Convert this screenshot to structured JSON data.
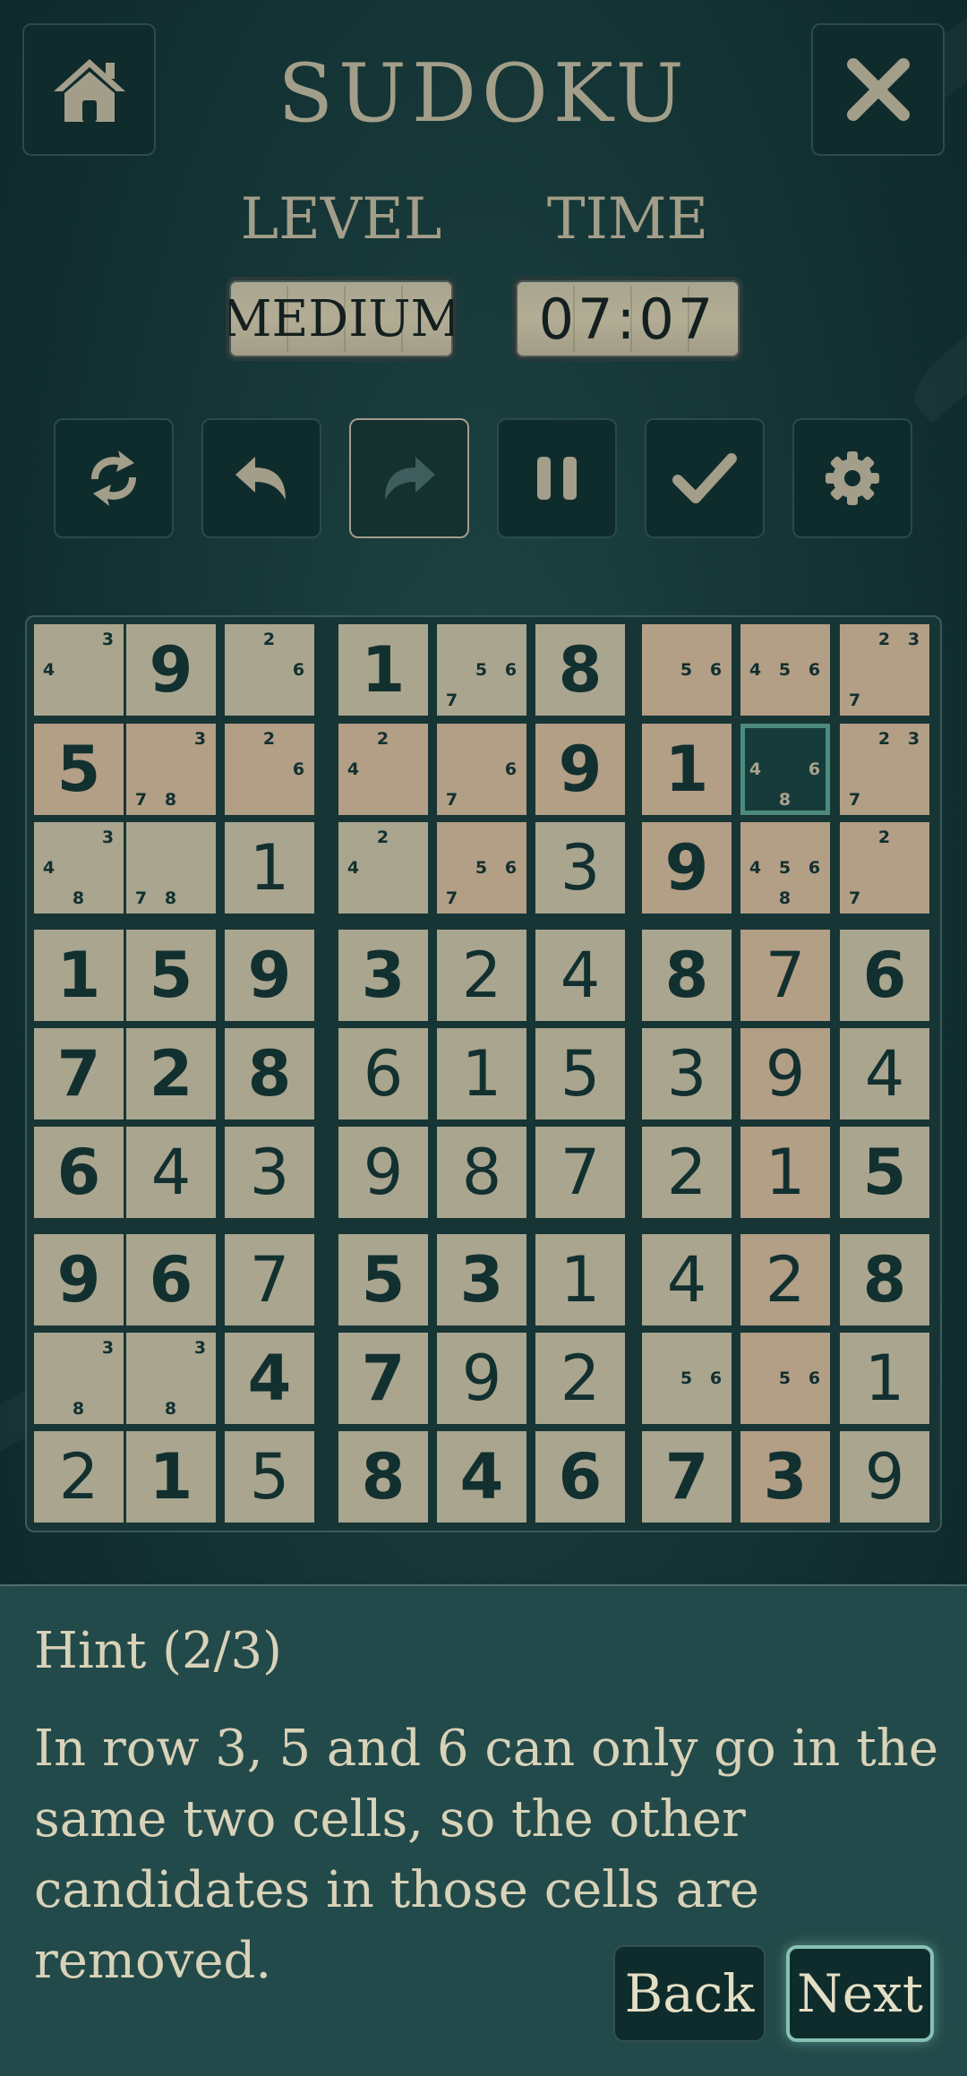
{
  "header": {
    "title": "SUDOKU",
    "level_label": "LEVEL",
    "level_value": "MEDIUM",
    "time_label": "TIME",
    "time_value": "07:07"
  },
  "icons": {
    "home": "home-icon",
    "close": "close-icon",
    "toolbar": [
      "shuffle-icon",
      "undo-icon",
      "redo-icon",
      "pause-icon",
      "check-icon",
      "gear-icon"
    ]
  },
  "colors": {
    "cell": "#aaa58f",
    "cell_highlight": "#b39e86",
    "cell_selected": "#173a3a",
    "selected_border": "#4b8b7e",
    "digit": "#12302f",
    "accent": "#a39e89"
  },
  "board": {
    "rows": [
      [
        {
          "n": [
            3,
            4
          ]
        },
        {
          "v": 9,
          "g": true
        },
        {
          "n": [
            2,
            6
          ]
        },
        {
          "v": 1,
          "g": true
        },
        {
          "n": [
            5,
            6,
            7
          ]
        },
        {
          "v": 8,
          "g": true
        },
        {
          "n": [
            5,
            6
          ],
          "h": true
        },
        {
          "n": [
            4,
            5,
            6
          ],
          "h": true
        },
        {
          "n": [
            2,
            3,
            7
          ],
          "h": true
        }
      ],
      [
        {
          "v": 5,
          "g": true,
          "h": true
        },
        {
          "n": [
            3,
            7,
            8
          ],
          "h": true
        },
        {
          "n": [
            2,
            6
          ],
          "h": true
        },
        {
          "n": [
            2,
            4
          ],
          "h": true
        },
        {
          "n": [
            6,
            7
          ],
          "h": true
        },
        {
          "v": 9,
          "g": true,
          "h": true
        },
        {
          "v": 1,
          "g": true,
          "h": true
        },
        {
          "n": [
            4,
            6,
            8
          ],
          "sel": true
        },
        {
          "n": [
            2,
            3,
            7
          ],
          "h": true
        }
      ],
      [
        {
          "n": [
            3,
            4,
            8
          ]
        },
        {
          "n": [
            7,
            8
          ]
        },
        {
          "v": 1,
          "g": false
        },
        {
          "n": [
            2,
            4
          ]
        },
        {
          "n": [
            5,
            6,
            7
          ],
          "h": true
        },
        {
          "v": 3,
          "g": false
        },
        {
          "v": 9,
          "g": true,
          "h": true
        },
        {
          "n": [
            4,
            5,
            6,
            8
          ],
          "h": true
        },
        {
          "n": [
            2,
            7
          ],
          "h": true
        }
      ],
      [
        {
          "v": 1,
          "g": true
        },
        {
          "v": 5,
          "g": true
        },
        {
          "v": 9,
          "g": true
        },
        {
          "v": 3,
          "g": true
        },
        {
          "v": 2,
          "g": false
        },
        {
          "v": 4,
          "g": false
        },
        {
          "v": 8,
          "g": true
        },
        {
          "v": 7,
          "g": false,
          "h": true
        },
        {
          "v": 6,
          "g": true
        }
      ],
      [
        {
          "v": 7,
          "g": true
        },
        {
          "v": 2,
          "g": true
        },
        {
          "v": 8,
          "g": true
        },
        {
          "v": 6,
          "g": false
        },
        {
          "v": 1,
          "g": false
        },
        {
          "v": 5,
          "g": false
        },
        {
          "v": 3,
          "g": false
        },
        {
          "v": 9,
          "g": false,
          "h": true
        },
        {
          "v": 4,
          "g": false
        }
      ],
      [
        {
          "v": 6,
          "g": true
        },
        {
          "v": 4,
          "g": false
        },
        {
          "v": 3,
          "g": false
        },
        {
          "v": 9,
          "g": false
        },
        {
          "v": 8,
          "g": false
        },
        {
          "v": 7,
          "g": false
        },
        {
          "v": 2,
          "g": false
        },
        {
          "v": 1,
          "g": false,
          "h": true
        },
        {
          "v": 5,
          "g": true
        }
      ],
      [
        {
          "v": 9,
          "g": true
        },
        {
          "v": 6,
          "g": true
        },
        {
          "v": 7,
          "g": false
        },
        {
          "v": 5,
          "g": true
        },
        {
          "v": 3,
          "g": true
        },
        {
          "v": 1,
          "g": false
        },
        {
          "v": 4,
          "g": false
        },
        {
          "v": 2,
          "g": false,
          "h": true
        },
        {
          "v": 8,
          "g": true
        }
      ],
      [
        {
          "n": [
            3,
            8
          ]
        },
        {
          "n": [
            3,
            8
          ]
        },
        {
          "v": 4,
          "g": true
        },
        {
          "v": 7,
          "g": true
        },
        {
          "v": 9,
          "g": false
        },
        {
          "v": 2,
          "g": false
        },
        {
          "n": [
            5,
            6
          ]
        },
        {
          "n": [
            5,
            6
          ],
          "h": true
        },
        {
          "v": 1,
          "g": false
        }
      ],
      [
        {
          "v": 2,
          "g": false
        },
        {
          "v": 1,
          "g": true
        },
        {
          "v": 5,
          "g": false
        },
        {
          "v": 8,
          "g": true
        },
        {
          "v": 4,
          "g": true
        },
        {
          "v": 6,
          "g": true
        },
        {
          "v": 7,
          "g": true
        },
        {
          "v": 3,
          "g": true,
          "h": true
        },
        {
          "v": 9,
          "g": false
        }
      ]
    ]
  },
  "hint": {
    "title": "Hint (2/3)",
    "text": "In row 3, 5 and 6 can only go in the same two cells, so the other candidates in those cells are removed.",
    "back_label": "Back",
    "next_label": "Next"
  }
}
